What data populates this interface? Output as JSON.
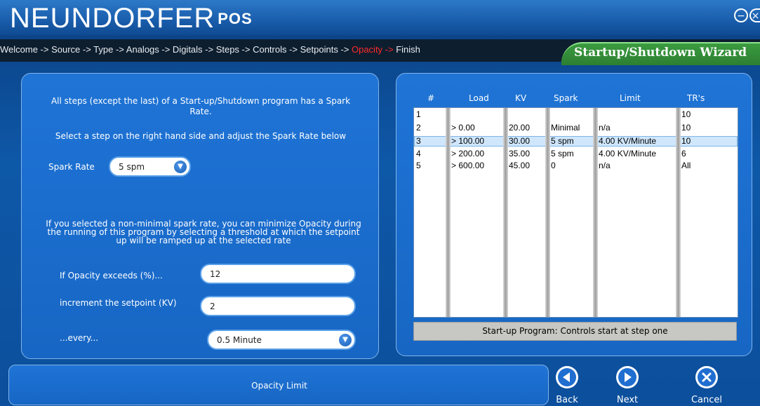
{
  "app": {
    "brand": "NEUNDORFER",
    "brand_suffix": "POS"
  },
  "breadcrumb": {
    "before": "Welcome -> Source -> Type -> Analogs -> Digitals -> Steps -> Controls -> Setpoints -> ",
    "current": "Opacity -> ",
    "after": "Finish"
  },
  "wizard_title": "Startup/Shutdown Wizard",
  "left": {
    "intro": "All steps (except the last) of a Start-up/Shutdown program has a Spark Rate.",
    "instruction": "Select a step on the right hand side and adjust the Spark Rate below",
    "spark_rate_label": "Spark Rate",
    "spark_rate_value": "5  spm",
    "opacity_info": "If you selected a non-minimal spark rate, you can minimize Opacity during the running of this program by selecting a threshold at which the setpoint up will be ramped up at the selected rate",
    "opacity_exceeds_label": "If Opacity exceeds (%)...",
    "opacity_exceeds_value": "12",
    "increment_label": "increment the setpoint (KV)",
    "increment_value": "2",
    "every_label": "...every...",
    "every_value": "0.5 Minute"
  },
  "table": {
    "headers": [
      "#",
      "Load",
      "KV",
      "Spark",
      "Limit",
      "TR's"
    ],
    "rows": [
      [
        "1",
        "",
        "",
        "",
        "",
        "10"
      ],
      [
        "2",
        "> 0.00",
        "20.00",
        "Minimal",
        "n/a",
        "10"
      ],
      [
        "3",
        "> 100.00",
        "30.00",
        "5  spm",
        "4.00 KV/Minute",
        "10"
      ],
      [
        "4",
        "> 200.00",
        "35.00",
        "5  spm",
        "4.00 KV/Minute",
        "6"
      ],
      [
        "5",
        "> 600.00",
        "45.00",
        "0",
        "n/a",
        "All"
      ]
    ],
    "selected_row": 3,
    "status": "Start-up Program: Controls start at step one"
  },
  "bottom_label": "Opacity Limit",
  "buttons": {
    "back": "Back",
    "next": "Next",
    "cancel": "Cancel"
  },
  "colors": {
    "accent_blue": "#1766c4",
    "wizard_green": "#2c7f32",
    "current_step_red": "#ff2a2a"
  }
}
